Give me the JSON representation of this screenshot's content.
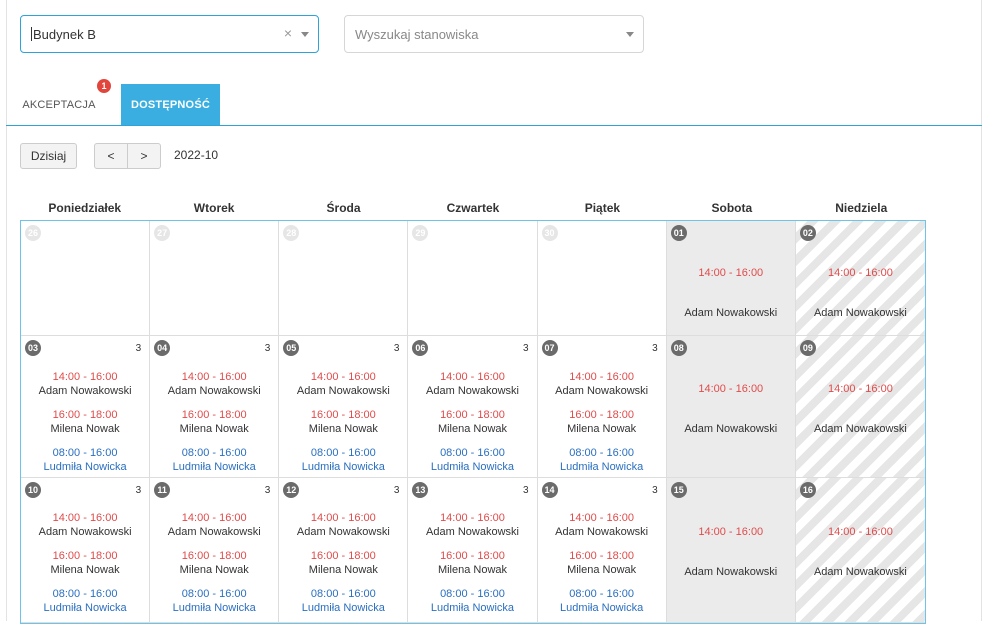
{
  "filters": {
    "building_value": "Budynek B",
    "search_placeholder": "Wyszukaj stanowiska",
    "clear_symbol": "×"
  },
  "tabs": [
    {
      "label": "AKCEPTACJA",
      "badge": "1",
      "active": false
    },
    {
      "label": "DOSTĘPNOŚĆ",
      "active": true
    }
  ],
  "toolbar": {
    "today_label": "Dzisiaj",
    "prev_label": "<",
    "next_label": ">",
    "period": "2022-10"
  },
  "calendar": {
    "weekdays": [
      "Poniedziałek",
      "Wtorek",
      "Środa",
      "Czwartek",
      "Piątek",
      "Sobota",
      "Niedziela"
    ],
    "weeks": [
      {
        "days": [
          {
            "num": "26",
            "other": true
          },
          {
            "num": "27",
            "other": true
          },
          {
            "num": "28",
            "other": true
          },
          {
            "num": "29",
            "other": true
          },
          {
            "num": "30",
            "other": true
          },
          {
            "num": "01",
            "weekend": "sat",
            "time": "14:00 - 16:00",
            "name": "Adam Nowakowski"
          },
          {
            "num": "02",
            "weekend": "sun",
            "time": "14:00 - 16:00",
            "name": "Adam Nowakowski"
          }
        ]
      },
      {
        "days": [
          {
            "num": "03",
            "count": "3",
            "entries": [
              {
                "time": "14:00 - 16:00",
                "name": "Adam Nowakowski"
              },
              {
                "time": "16:00 - 18:00",
                "name": "Milena Nowak"
              },
              {
                "time": "08:00 - 16:00",
                "name": "Ludmiła Nowicka"
              }
            ]
          },
          {
            "num": "04",
            "count": "3",
            "entries": [
              {
                "time": "14:00 - 16:00",
                "name": "Adam Nowakowski"
              },
              {
                "time": "16:00 - 18:00",
                "name": "Milena Nowak"
              },
              {
                "time": "08:00 - 16:00",
                "name": "Ludmiła Nowicka"
              }
            ]
          },
          {
            "num": "05",
            "count": "3",
            "entries": [
              {
                "time": "14:00 - 16:00",
                "name": "Adam Nowakowski"
              },
              {
                "time": "16:00 - 18:00",
                "name": "Milena Nowak"
              },
              {
                "time": "08:00 - 16:00",
                "name": "Ludmiła Nowicka"
              }
            ]
          },
          {
            "num": "06",
            "count": "3",
            "entries": [
              {
                "time": "14:00 - 16:00",
                "name": "Adam Nowakowski"
              },
              {
                "time": "16:00 - 18:00",
                "name": "Milena Nowak"
              },
              {
                "time": "08:00 - 16:00",
                "name": "Ludmiła Nowicka"
              }
            ]
          },
          {
            "num": "07",
            "count": "3",
            "entries": [
              {
                "time": "14:00 - 16:00",
                "name": "Adam Nowakowski"
              },
              {
                "time": "16:00 - 18:00",
                "name": "Milena Nowak"
              },
              {
                "time": "08:00 - 16:00",
                "name": "Ludmiła Nowicka"
              }
            ]
          },
          {
            "num": "08",
            "weekend": "sat",
            "time": "14:00 - 16:00",
            "name": "Adam Nowakowski"
          },
          {
            "num": "09",
            "weekend": "sun",
            "time": "14:00 - 16:00",
            "name": "Adam Nowakowski"
          }
        ]
      },
      {
        "days": [
          {
            "num": "10",
            "count": "3",
            "entries": [
              {
                "time": "14:00 - 16:00",
                "name": "Adam Nowakowski"
              },
              {
                "time": "16:00 - 18:00",
                "name": "Milena Nowak"
              },
              {
                "time": "08:00 - 16:00",
                "name": "Ludmiła Nowicka"
              }
            ]
          },
          {
            "num": "11",
            "count": "3",
            "entries": [
              {
                "time": "14:00 - 16:00",
                "name": "Adam Nowakowski"
              },
              {
                "time": "16:00 - 18:00",
                "name": "Milena Nowak"
              },
              {
                "time": "08:00 - 16:00",
                "name": "Ludmiła Nowicka"
              }
            ]
          },
          {
            "num": "12",
            "count": "3",
            "entries": [
              {
                "time": "14:00 - 16:00",
                "name": "Adam Nowakowski"
              },
              {
                "time": "16:00 - 18:00",
                "name": "Milena Nowak"
              },
              {
                "time": "08:00 - 16:00",
                "name": "Ludmiła Nowicka"
              }
            ]
          },
          {
            "num": "13",
            "count": "3",
            "entries": [
              {
                "time": "14:00 - 16:00",
                "name": "Adam Nowakowski"
              },
              {
                "time": "16:00 - 18:00",
                "name": "Milena Nowak"
              },
              {
                "time": "08:00 - 16:00",
                "name": "Ludmiła Nowicka"
              }
            ]
          },
          {
            "num": "14",
            "count": "3",
            "entries": [
              {
                "time": "14:00 - 16:00",
                "name": "Adam Nowakowski"
              },
              {
                "time": "16:00 - 18:00",
                "name": "Milena Nowak"
              },
              {
                "time": "08:00 - 16:00",
                "name": "Ludmiła Nowicka"
              }
            ]
          },
          {
            "num": "15",
            "weekend": "sat",
            "time": "14:00 - 16:00",
            "name": "Adam Nowakowski"
          },
          {
            "num": "16",
            "weekend": "sun",
            "time": "14:00 - 16:00",
            "name": "Adam Nowakowski"
          }
        ]
      }
    ]
  },
  "colors": {
    "accent": "#3aaee0",
    "time_red": "#e04b4b",
    "name_blue": "#2a6fc0",
    "badge_red": "#e2453c"
  }
}
